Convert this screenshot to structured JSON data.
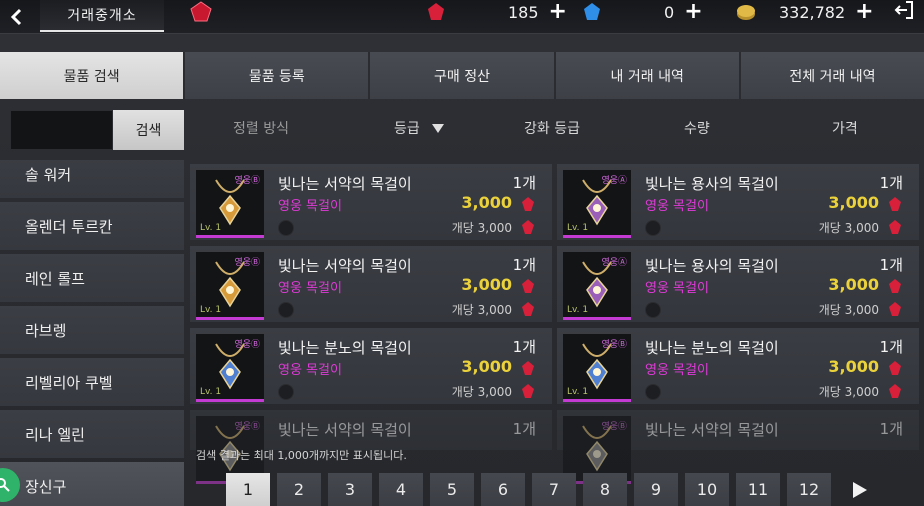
{
  "header": {
    "title": "거래중개소",
    "currencies": [
      {
        "name": "red-gem",
        "value": "185",
        "color": "#d8203a"
      },
      {
        "name": "blue-gem",
        "value": "0",
        "color": "#2f8ee8"
      },
      {
        "name": "gold-coin",
        "value": "332,782",
        "color": "#d6ad3b"
      }
    ]
  },
  "tabs": [
    {
      "label": "물품 검색",
      "active": true
    },
    {
      "label": "물품 등록",
      "active": false
    },
    {
      "label": "구매 정산",
      "active": false
    },
    {
      "label": "내 거래 내역",
      "active": false
    },
    {
      "label": "전체 거래 내역",
      "active": false
    }
  ],
  "search": {
    "button_label": "검색",
    "value": ""
  },
  "sort": {
    "method_label": "정렬 방식",
    "grade_label": "등급",
    "enhance_label": "강화 등급",
    "quantity_label": "수량",
    "price_label": "가격"
  },
  "categories": [
    {
      "label": "솔 워커"
    },
    {
      "label": "올렌더 투르칸"
    },
    {
      "label": "레인 롤프"
    },
    {
      "label": "라브렝"
    },
    {
      "label": "리벨리아 쿠벨"
    },
    {
      "label": "리나 엘린"
    },
    {
      "label": "장신구",
      "selected": true
    }
  ],
  "items": [
    {
      "name": "빛나는 서약의 목걸이",
      "qty": "1개",
      "grade": "영웅 목걸이",
      "price": "3,000",
      "unit_price": "개당 3,000",
      "badge": "영웅Ⓑ",
      "level": "Lv. 1",
      "color": "#d79a3a"
    },
    {
      "name": "빛나는 용사의 목걸이",
      "qty": "1개",
      "grade": "영웅 목걸이",
      "price": "3,000",
      "unit_price": "개당 3,000",
      "badge": "영웅Ⓐ",
      "level": "Lv. 1",
      "color": "#9a5fb8"
    },
    {
      "name": "빛나는 서약의 목걸이",
      "qty": "1개",
      "grade": "영웅 목걸이",
      "price": "3,000",
      "unit_price": "개당 3,000",
      "badge": "영웅Ⓑ",
      "level": "Lv. 1",
      "color": "#d79a3a"
    },
    {
      "name": "빛나는 용사의 목걸이",
      "qty": "1개",
      "grade": "영웅 목걸이",
      "price": "3,000",
      "unit_price": "개당 3,000",
      "badge": "영웅Ⓐ",
      "level": "Lv. 1",
      "color": "#9a5fb8"
    },
    {
      "name": "빛나는 분노의 목걸이",
      "qty": "1개",
      "grade": "영웅 목걸이",
      "price": "3,000",
      "unit_price": "개당 3,000",
      "badge": "영웅Ⓑ",
      "level": "Lv. 1",
      "color": "#4f7fd0"
    },
    {
      "name": "빛나는 분노의 목걸이",
      "qty": "1개",
      "grade": "영웅 목걸이",
      "price": "3,000",
      "unit_price": "개당 3,000",
      "badge": "영웅Ⓑ",
      "level": "Lv. 1",
      "color": "#4f7fd0"
    },
    {
      "name": "빛나는 서약의 목걸이",
      "qty": "1개",
      "badge": "영웅Ⓑ"
    },
    {
      "name": "빛나는 서약의 목걸이",
      "qty": "1개",
      "badge": "영웅Ⓑ"
    }
  ],
  "footer": {
    "note": "검색 결과는 최대 1,000개까지만 표시됩니다.",
    "pages": [
      "1",
      "2",
      "3",
      "4",
      "5",
      "6",
      "7",
      "8",
      "9",
      "10",
      "11",
      "12"
    ],
    "current_page": "1"
  }
}
